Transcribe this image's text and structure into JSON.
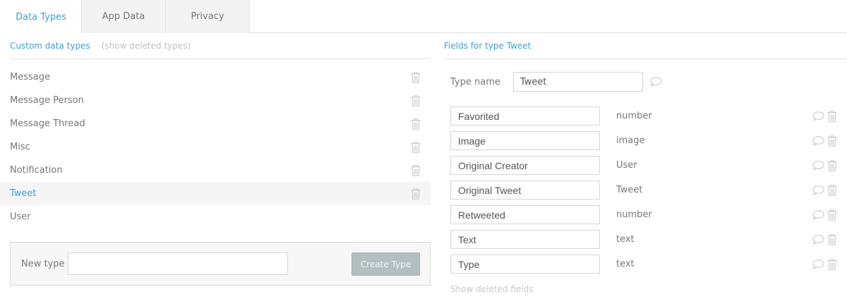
{
  "tabs": [
    {
      "label": "Data Types",
      "active": true
    },
    {
      "label": "App Data",
      "active": false
    },
    {
      "label": "Privacy",
      "active": false
    }
  ],
  "left": {
    "title": "Custom data types",
    "show_deleted": "(show deleted types)",
    "types": [
      {
        "label": "Message",
        "selected": false,
        "has_trash": true
      },
      {
        "label": "Message Person",
        "selected": false,
        "has_trash": true
      },
      {
        "label": "Message Thread",
        "selected": false,
        "has_trash": true
      },
      {
        "label": "Misc",
        "selected": false,
        "has_trash": true
      },
      {
        "label": "Notification",
        "selected": false,
        "has_trash": true
      },
      {
        "label": "Tweet",
        "selected": true,
        "has_trash": true
      },
      {
        "label": "User",
        "selected": false,
        "has_trash": false
      }
    ],
    "new_type": {
      "label": "New type",
      "value": "",
      "button": "Create Type"
    }
  },
  "right": {
    "title": "Fields for type Tweet",
    "type_name_label": "Type name",
    "type_name_value": "Tweet",
    "fields": [
      {
        "name": "Favorited",
        "type": "number"
      },
      {
        "name": "Image",
        "type": "image"
      },
      {
        "name": "Original Creator",
        "type": "User"
      },
      {
        "name": "Original Tweet",
        "type": "Tweet"
      },
      {
        "name": "Retweeted",
        "type": "number"
      },
      {
        "name": "Text",
        "type": "text"
      },
      {
        "name": "Type",
        "type": "text"
      }
    ],
    "show_deleted_fields": "Show deleted fields"
  },
  "icons": {
    "trash": "trash-icon",
    "comment": "comment-icon"
  },
  "colors": {
    "accent": "#3e9fd6",
    "button_disabled": "#b3bec1",
    "icon": "#c8c8c8"
  }
}
